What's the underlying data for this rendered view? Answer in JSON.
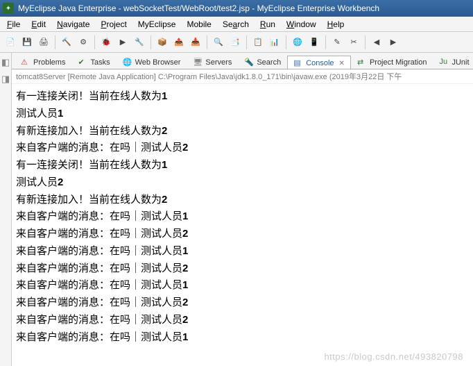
{
  "window": {
    "title": "MyEclipse Java Enterprise - webSocketTest/WebRoot/test2.jsp - MyEclipse Enterprise Workbench"
  },
  "menubar": [
    {
      "label": "File",
      "u": "F"
    },
    {
      "label": "Edit",
      "u": "E"
    },
    {
      "label": "Navigate",
      "u": "N"
    },
    {
      "label": "Project",
      "u": "P"
    },
    {
      "label": "MyEclipse",
      "u": ""
    },
    {
      "label": "Mobile",
      "u": ""
    },
    {
      "label": "Search",
      "u": "a"
    },
    {
      "label": "Run",
      "u": "R"
    },
    {
      "label": "Window",
      "u": "W"
    },
    {
      "label": "Help",
      "u": "H"
    }
  ],
  "toolbar": [
    "📄",
    "💾",
    "🖨",
    "│",
    "🔨",
    "⚙",
    "│",
    "🐞",
    "▶",
    "🔧",
    "│",
    "📦",
    "📤",
    "📥",
    "│",
    "🔍",
    "📑",
    "│",
    "📋",
    "📊",
    "│",
    "🌐",
    "📱",
    "│",
    "✎",
    "✂",
    "│",
    "◀",
    "▶"
  ],
  "leftbar": [
    "◧",
    "◨"
  ],
  "tabs": [
    {
      "label": "Problems",
      "icon": "⚠",
      "iconColor": "#c04040"
    },
    {
      "label": "Tasks",
      "icon": "✔",
      "iconColor": "#3a7a3a"
    },
    {
      "label": "Web Browser",
      "icon": "🌐",
      "iconColor": "#3a6ea5"
    },
    {
      "label": "Servers",
      "icon": "🖥",
      "iconColor": "#888"
    },
    {
      "label": "Search",
      "icon": "🔦",
      "iconColor": "#c8a030"
    },
    {
      "label": "Console",
      "icon": "▤",
      "iconColor": "#3a6ea5",
      "active": true,
      "closeable": true
    },
    {
      "label": "Project Migration",
      "icon": "⇄",
      "iconColor": "#3a7a3a"
    },
    {
      "label": "JUnit",
      "icon": "Ju",
      "iconColor": "#3a7a3a"
    }
  ],
  "launch": "tomcat8Server [Remote Java Application] C:\\Program Files\\Java\\jdk1.8.0_171\\bin\\javaw.exe (2019年3月22日 下午",
  "console_lines": [
    [
      [
        "有一连接关闭！当前在线人数为",
        false
      ],
      [
        "1",
        true
      ]
    ],
    [
      [
        "测试人员",
        false
      ],
      [
        "1",
        true
      ]
    ],
    [
      [
        "有新连接加入！当前在线人数为",
        false
      ],
      [
        "2",
        true
      ]
    ],
    [
      [
        "来自客户端的消息：在吗｜测试人员",
        false
      ],
      [
        "2",
        true
      ]
    ],
    [
      [
        "有一连接关闭！当前在线人数为",
        false
      ],
      [
        "1",
        true
      ]
    ],
    [
      [
        "测试人员",
        false
      ],
      [
        "2",
        true
      ]
    ],
    [
      [
        "有新连接加入！当前在线人数为",
        false
      ],
      [
        "2",
        true
      ]
    ],
    [
      [
        "来自客户端的消息：在吗｜测试人员",
        false
      ],
      [
        "1",
        true
      ]
    ],
    [
      [
        "来自客户端的消息：在吗｜测试人员",
        false
      ],
      [
        "2",
        true
      ]
    ],
    [
      [
        "来自客户端的消息：在吗｜测试人员",
        false
      ],
      [
        "1",
        true
      ]
    ],
    [
      [
        "来自客户端的消息：在吗｜测试人员",
        false
      ],
      [
        "2",
        true
      ]
    ],
    [
      [
        "来自客户端的消息：在吗｜测试人员",
        false
      ],
      [
        "1",
        true
      ]
    ],
    [
      [
        "来自客户端的消息：在吗｜测试人员",
        false
      ],
      [
        "2",
        true
      ]
    ],
    [
      [
        "来自客户端的消息：在吗｜测试人员",
        false
      ],
      [
        "2",
        true
      ]
    ],
    [
      [
        "来自客户端的消息：在吗｜测试人员",
        false
      ],
      [
        "1",
        true
      ]
    ]
  ],
  "watermark": "https://blog.csdn.net/493820798"
}
